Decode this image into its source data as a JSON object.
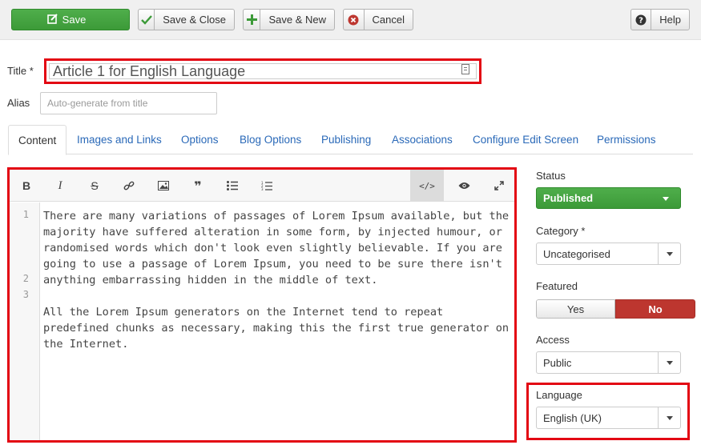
{
  "toolbar": {
    "save_label": "Save",
    "save_close_label": "Save & Close",
    "save_new_label": "Save & New",
    "cancel_label": "Cancel",
    "help_label": "Help"
  },
  "form": {
    "title_label": "Title *",
    "title_value": "Article 1 for English Language",
    "alias_label": "Alias",
    "alias_placeholder": "Auto-generate from title"
  },
  "tabs": [
    {
      "label": "Content",
      "active": true
    },
    {
      "label": "Images and Links"
    },
    {
      "label": "Options"
    },
    {
      "label": "Blog Options"
    },
    {
      "label": "Publishing"
    },
    {
      "label": "Associations"
    },
    {
      "label": "Configure Edit Screen"
    },
    {
      "label": "Permissions"
    }
  ],
  "editor": {
    "toolbar_icons": [
      "bold-icon",
      "italic-icon",
      "strikethrough-icon",
      "link-icon",
      "image-icon",
      "quote-icon",
      "bullet-list-icon",
      "numbered-list-icon",
      "code-view-icon",
      "preview-icon",
      "fullscreen-icon"
    ],
    "line_numbers": [
      "1",
      "2",
      "3"
    ],
    "lines": [
      "There are many variations of passages of Lorem Ipsum available, but the majority have suffered alteration in some form, by injected humour, or randomised words which don't look even slightly believable. If you are going to use a passage of Lorem Ipsum, you need to be sure there isn't anything embarrassing hidden in the middle of text.",
      "",
      "All the Lorem Ipsum generators on the Internet tend to repeat predefined chunks as necessary, making this the first true generator on the Internet."
    ]
  },
  "sidebar": {
    "status_label": "Status",
    "status_value": "Published",
    "category_label": "Category *",
    "category_value": "Uncategorised",
    "featured_label": "Featured",
    "featured_yes": "Yes",
    "featured_no": "No",
    "featured_selected": "No",
    "access_label": "Access",
    "access_value": "Public",
    "language_label": "Language",
    "language_value": "English (UK)"
  },
  "colors": {
    "highlight": "#e30613",
    "success": "#46a546",
    "danger": "#bd362f",
    "link": "#2a69b8"
  }
}
